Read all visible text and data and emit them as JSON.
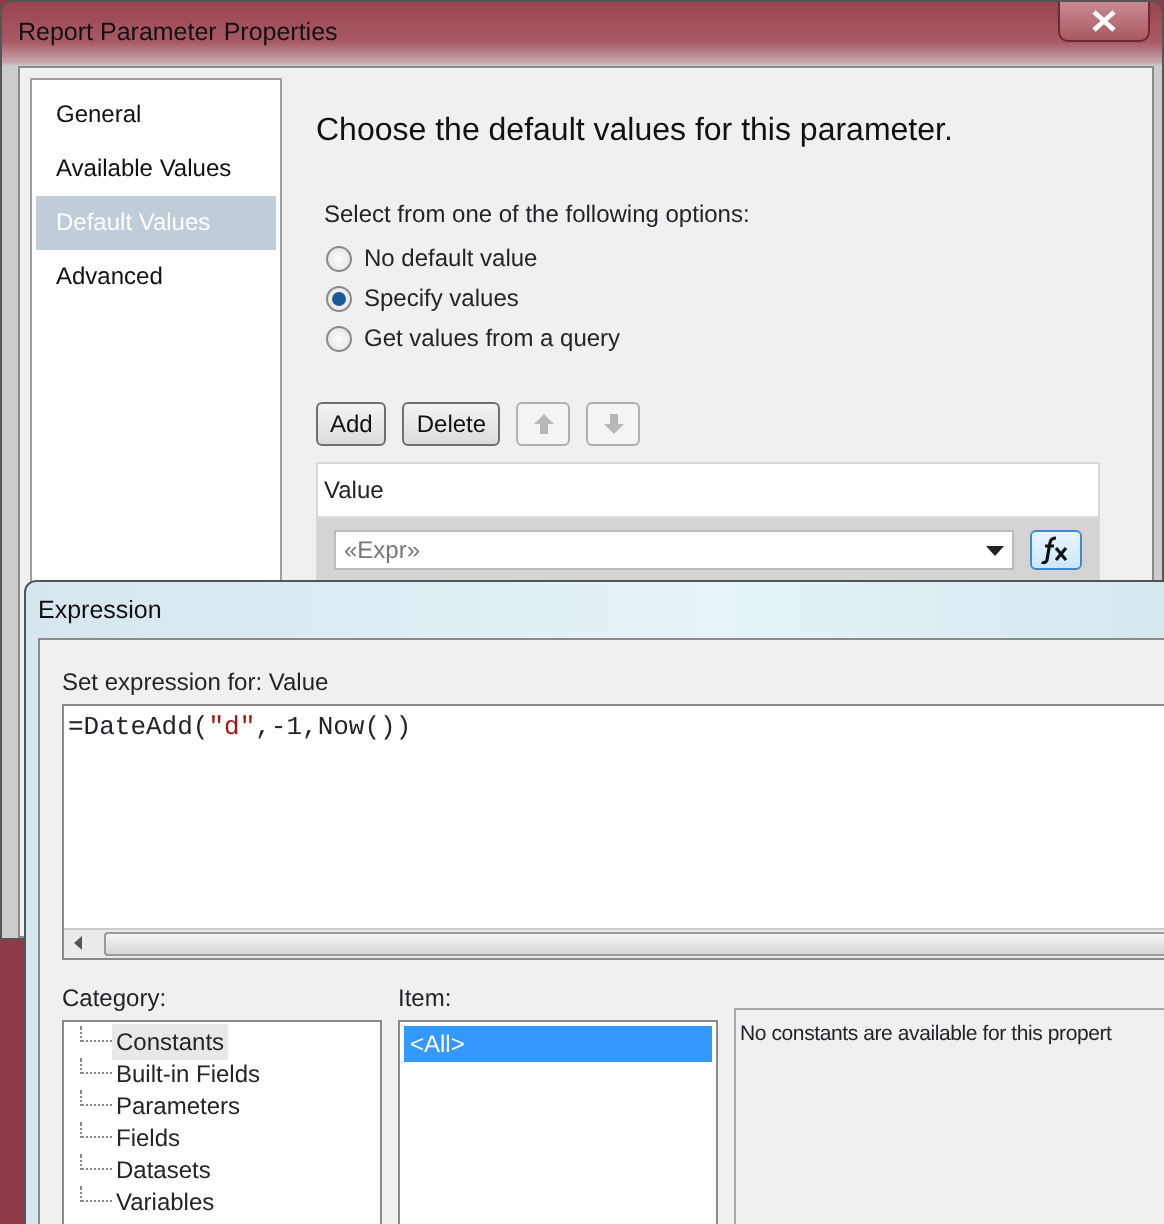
{
  "window": {
    "title": "Report Parameter Properties"
  },
  "sidebar": {
    "items": [
      {
        "label": "General",
        "selected": false
      },
      {
        "label": "Available Values",
        "selected": false
      },
      {
        "label": "Default Values",
        "selected": true
      },
      {
        "label": "Advanced",
        "selected": false
      }
    ]
  },
  "heading": "Choose the default values for this parameter.",
  "options_label": "Select from one of the following options:",
  "options": [
    {
      "label": "No default value",
      "selected": false
    },
    {
      "label": "Specify values",
      "selected": true
    },
    {
      "label": "Get values from a query",
      "selected": false
    }
  ],
  "buttons": [
    {
      "kind": "text",
      "label": "Add",
      "disabled": false
    },
    {
      "kind": "text",
      "label": "Delete",
      "disabled": false
    },
    {
      "kind": "up",
      "disabled": true
    },
    {
      "kind": "down",
      "disabled": true
    }
  ],
  "values_grid": {
    "column": "Value",
    "rows": [
      {
        "placeholder": "«Expr»"
      }
    ]
  },
  "expression_dialog": {
    "title": "Expression",
    "label": "Set expression for: Value",
    "expression": [
      {
        "kind": "code",
        "text": "=DateAdd("
      },
      {
        "kind": "string",
        "text": "\"d\""
      },
      {
        "kind": "code",
        "text": ",-1,Now()"
      },
      {
        "kind": "code",
        "text": ")"
      }
    ],
    "category_label": "Category:",
    "categories": [
      {
        "label": "Constants",
        "selected": true
      },
      {
        "label": "Built-in Fields",
        "selected": false
      },
      {
        "label": "Parameters",
        "selected": false
      },
      {
        "label": "Fields",
        "selected": false
      },
      {
        "label": "Datasets",
        "selected": false
      },
      {
        "label": "Variables",
        "selected": false
      }
    ],
    "item_label": "Item:",
    "items": [
      {
        "label": "<All>",
        "selected": true
      }
    ],
    "description": "No constants are available for this propert"
  }
}
